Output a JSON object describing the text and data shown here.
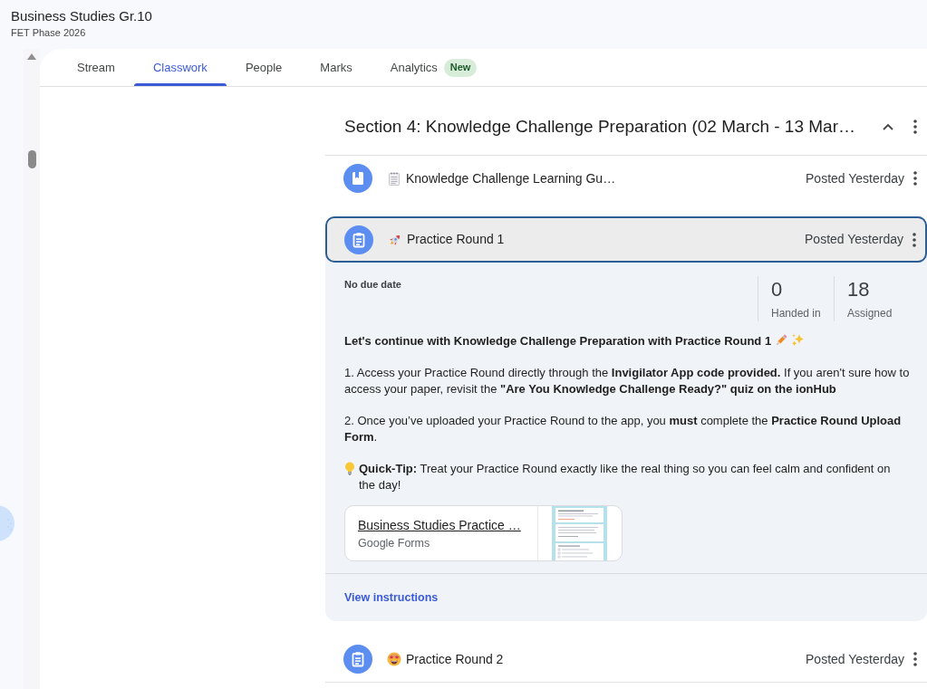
{
  "course": {
    "title": "Business Studies Gr.10",
    "subtitle": "FET Phase 2026"
  },
  "tabs": [
    {
      "label": "Stream",
      "selected": false
    },
    {
      "label": "Classwork",
      "selected": true
    },
    {
      "label": "People",
      "selected": false
    },
    {
      "label": "Marks",
      "selected": false
    },
    {
      "label": "Analytics",
      "selected": false,
      "badge": "New"
    }
  ],
  "section": {
    "title": "Section 4: Knowledge Challenge Preparation (02 March - 13 Mar…",
    "expanded": true,
    "items": [
      {
        "kind": "material",
        "title": "Knowledge Challenge Learning Gu…",
        "posted": "Posted Yesterday",
        "expanded": false
      },
      {
        "kind": "assignment",
        "title": "Practice Round 1",
        "posted": "Posted Yesterday",
        "expanded": true,
        "details": {
          "due": "No due date",
          "stats": [
            {
              "value": "0",
              "label": "Handed in"
            },
            {
              "value": "18",
              "label": "Assigned"
            }
          ],
          "description": [
            {
              "kind": "lead",
              "text": "Let's continue with Knowledge Challenge Preparation with Practice Round 1"
            },
            {
              "kind": "text",
              "text": "1. Access your Practice Round directly through the **Invigilator App code provided.** If you aren't sure how to access your paper, revisit the **\"Are You Knowledge Challenge Ready?\" quiz on the ionHub**"
            },
            {
              "kind": "text",
              "text": "2. Once you’ve uploaded your Practice Round to the app, you **must** complete the **Practice Round Upload Form**."
            },
            {
              "kind": "tip",
              "text": "**Quick-Tip:** Treat your Practice Round exactly like the real thing so you can feel calm and confident on the day!"
            }
          ],
          "attachment": {
            "title": "Business Studies Practice …",
            "source": "Google Forms"
          },
          "link": "View instructions"
        }
      },
      {
        "kind": "assignment",
        "title": "Practice Round 2",
        "posted": "Posted Yesterday",
        "expanded": false
      }
    ]
  }
}
